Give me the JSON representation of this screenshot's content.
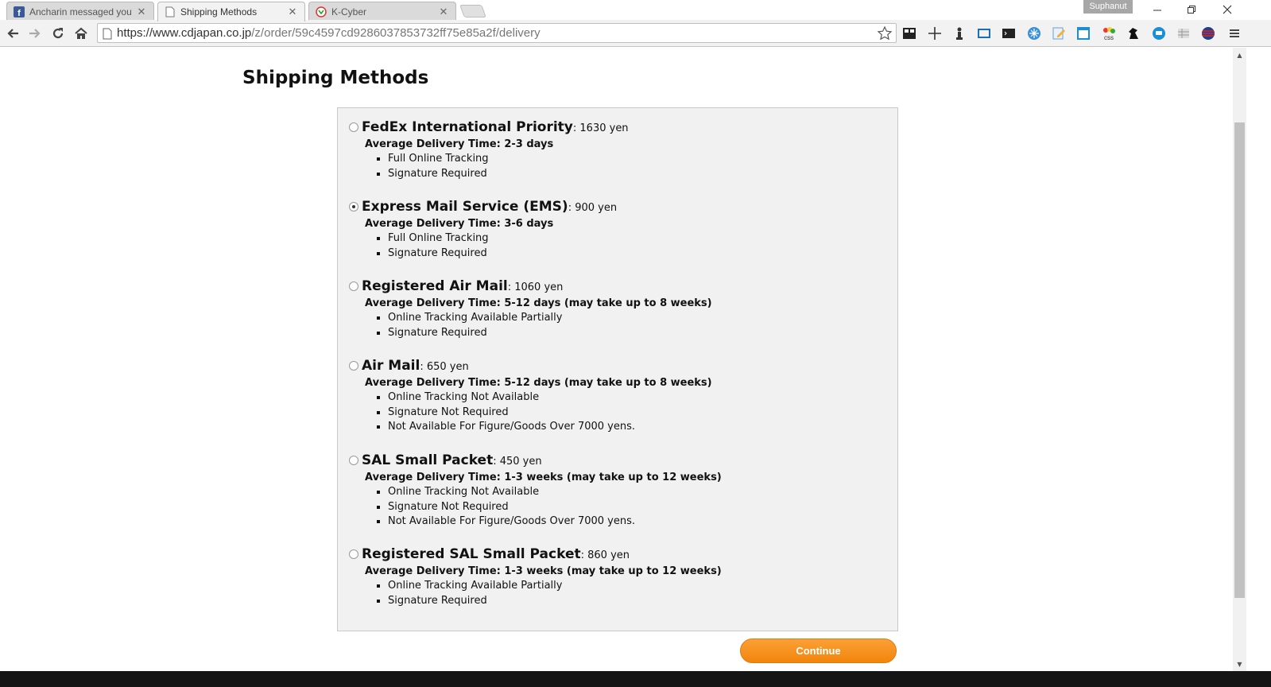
{
  "browser": {
    "tabs": [
      {
        "title": "Ancharin messaged you",
        "favicon": "facebook-icon",
        "active": false
      },
      {
        "title": "Shipping Methods",
        "favicon": "page-icon",
        "active": true
      },
      {
        "title": "K-Cyber",
        "favicon": "k-cyber-icon",
        "active": false
      }
    ],
    "profile_name": "Suphanut",
    "url_host": "https://www.cdjapan.co.jp",
    "url_path": "/z/order/59c4597cd9286037853732ff75e85a2f/delivery",
    "extensions": [
      "ext-reader-icon",
      "ext-ruler-icon",
      "ext-chess-icon",
      "ext-screen-icon",
      "ext-terminal-icon",
      "ext-snowflake-icon",
      "ext-edit-icon",
      "ext-window-icon",
      "ext-css-icon",
      "ext-horse-icon",
      "ext-chat-icon",
      "ext-grid-icon",
      "ext-flag-icon"
    ]
  },
  "page": {
    "title": "Shipping Methods",
    "selected_method": "ems",
    "methods": [
      {
        "id": "fedex",
        "name": "FedEx International Priority",
        "price": ": 1630 yen",
        "avg": "Average Delivery Time: 2-3 days",
        "features": [
          "Full Online Tracking",
          "Signature Required"
        ]
      },
      {
        "id": "ems",
        "name": "Express Mail Service (EMS)",
        "price": ": 900 yen",
        "avg": "Average Delivery Time: 3-6 days",
        "features": [
          "Full Online Tracking",
          "Signature Required"
        ]
      },
      {
        "id": "registered_air_mail",
        "name": "Registered Air Mail",
        "price": ": 1060 yen",
        "avg": "Average Delivery Time: 5-12 days (may take up to 8 weeks)",
        "features": [
          "Online Tracking Available Partially",
          "Signature Required"
        ]
      },
      {
        "id": "air_mail",
        "name": "Air Mail",
        "price": ": 650 yen",
        "avg": "Average Delivery Time: 5-12 days (may take up to 8 weeks)",
        "features": [
          "Online Tracking Not Available",
          "Signature Not Required",
          "Not Available For Figure/Goods Over 7000 yens."
        ]
      },
      {
        "id": "sal_small_packet",
        "name": "SAL Small Packet",
        "price": ": 450 yen",
        "avg": "Average Delivery Time: 1-3 weeks (may take up to 12 weeks)",
        "features": [
          "Online Tracking Not Available",
          "Signature Not Required",
          "Not Available For Figure/Goods Over 7000 yens."
        ]
      },
      {
        "id": "registered_sal_small_packet",
        "name": "Registered SAL Small Packet",
        "price": ": 860 yen",
        "avg": "Average Delivery Time: 1-3 weeks (may take up to 12 weeks)",
        "features": [
          "Online Tracking Available Partially",
          "Signature Required"
        ]
      }
    ],
    "continue_label": "Continue"
  },
  "colors": {
    "accent": "#f7931e",
    "box_bg": "#f1f1f1"
  }
}
